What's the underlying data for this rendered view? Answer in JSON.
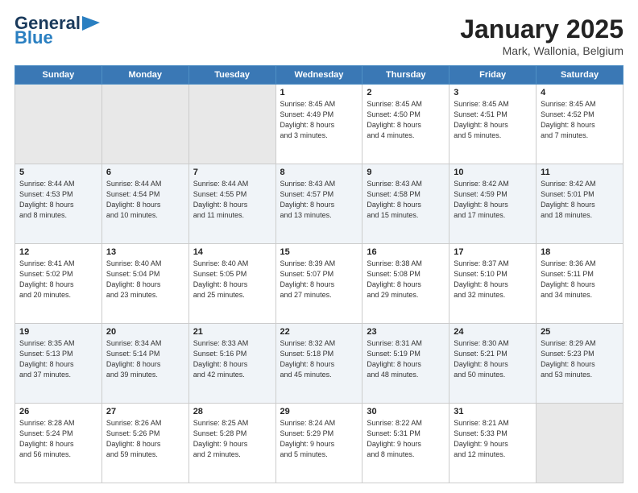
{
  "header": {
    "logo_line1": "General",
    "logo_line2": "Blue",
    "title": "January 2025",
    "subtitle": "Mark, Wallonia, Belgium"
  },
  "weekdays": [
    "Sunday",
    "Monday",
    "Tuesday",
    "Wednesday",
    "Thursday",
    "Friday",
    "Saturday"
  ],
  "weeks": [
    [
      {
        "day": "",
        "text": ""
      },
      {
        "day": "",
        "text": ""
      },
      {
        "day": "",
        "text": ""
      },
      {
        "day": "1",
        "text": "Sunrise: 8:45 AM\nSunset: 4:49 PM\nDaylight: 8 hours\nand 3 minutes."
      },
      {
        "day": "2",
        "text": "Sunrise: 8:45 AM\nSunset: 4:50 PM\nDaylight: 8 hours\nand 4 minutes."
      },
      {
        "day": "3",
        "text": "Sunrise: 8:45 AM\nSunset: 4:51 PM\nDaylight: 8 hours\nand 5 minutes."
      },
      {
        "day": "4",
        "text": "Sunrise: 8:45 AM\nSunset: 4:52 PM\nDaylight: 8 hours\nand 7 minutes."
      }
    ],
    [
      {
        "day": "5",
        "text": "Sunrise: 8:44 AM\nSunset: 4:53 PM\nDaylight: 8 hours\nand 8 minutes."
      },
      {
        "day": "6",
        "text": "Sunrise: 8:44 AM\nSunset: 4:54 PM\nDaylight: 8 hours\nand 10 minutes."
      },
      {
        "day": "7",
        "text": "Sunrise: 8:44 AM\nSunset: 4:55 PM\nDaylight: 8 hours\nand 11 minutes."
      },
      {
        "day": "8",
        "text": "Sunrise: 8:43 AM\nSunset: 4:57 PM\nDaylight: 8 hours\nand 13 minutes."
      },
      {
        "day": "9",
        "text": "Sunrise: 8:43 AM\nSunset: 4:58 PM\nDaylight: 8 hours\nand 15 minutes."
      },
      {
        "day": "10",
        "text": "Sunrise: 8:42 AM\nSunset: 4:59 PM\nDaylight: 8 hours\nand 17 minutes."
      },
      {
        "day": "11",
        "text": "Sunrise: 8:42 AM\nSunset: 5:01 PM\nDaylight: 8 hours\nand 18 minutes."
      }
    ],
    [
      {
        "day": "12",
        "text": "Sunrise: 8:41 AM\nSunset: 5:02 PM\nDaylight: 8 hours\nand 20 minutes."
      },
      {
        "day": "13",
        "text": "Sunrise: 8:40 AM\nSunset: 5:04 PM\nDaylight: 8 hours\nand 23 minutes."
      },
      {
        "day": "14",
        "text": "Sunrise: 8:40 AM\nSunset: 5:05 PM\nDaylight: 8 hours\nand 25 minutes."
      },
      {
        "day": "15",
        "text": "Sunrise: 8:39 AM\nSunset: 5:07 PM\nDaylight: 8 hours\nand 27 minutes."
      },
      {
        "day": "16",
        "text": "Sunrise: 8:38 AM\nSunset: 5:08 PM\nDaylight: 8 hours\nand 29 minutes."
      },
      {
        "day": "17",
        "text": "Sunrise: 8:37 AM\nSunset: 5:10 PM\nDaylight: 8 hours\nand 32 minutes."
      },
      {
        "day": "18",
        "text": "Sunrise: 8:36 AM\nSunset: 5:11 PM\nDaylight: 8 hours\nand 34 minutes."
      }
    ],
    [
      {
        "day": "19",
        "text": "Sunrise: 8:35 AM\nSunset: 5:13 PM\nDaylight: 8 hours\nand 37 minutes."
      },
      {
        "day": "20",
        "text": "Sunrise: 8:34 AM\nSunset: 5:14 PM\nDaylight: 8 hours\nand 39 minutes."
      },
      {
        "day": "21",
        "text": "Sunrise: 8:33 AM\nSunset: 5:16 PM\nDaylight: 8 hours\nand 42 minutes."
      },
      {
        "day": "22",
        "text": "Sunrise: 8:32 AM\nSunset: 5:18 PM\nDaylight: 8 hours\nand 45 minutes."
      },
      {
        "day": "23",
        "text": "Sunrise: 8:31 AM\nSunset: 5:19 PM\nDaylight: 8 hours\nand 48 minutes."
      },
      {
        "day": "24",
        "text": "Sunrise: 8:30 AM\nSunset: 5:21 PM\nDaylight: 8 hours\nand 50 minutes."
      },
      {
        "day": "25",
        "text": "Sunrise: 8:29 AM\nSunset: 5:23 PM\nDaylight: 8 hours\nand 53 minutes."
      }
    ],
    [
      {
        "day": "26",
        "text": "Sunrise: 8:28 AM\nSunset: 5:24 PM\nDaylight: 8 hours\nand 56 minutes."
      },
      {
        "day": "27",
        "text": "Sunrise: 8:26 AM\nSunset: 5:26 PM\nDaylight: 8 hours\nand 59 minutes."
      },
      {
        "day": "28",
        "text": "Sunrise: 8:25 AM\nSunset: 5:28 PM\nDaylight: 9 hours\nand 2 minutes."
      },
      {
        "day": "29",
        "text": "Sunrise: 8:24 AM\nSunset: 5:29 PM\nDaylight: 9 hours\nand 5 minutes."
      },
      {
        "day": "30",
        "text": "Sunrise: 8:22 AM\nSunset: 5:31 PM\nDaylight: 9 hours\nand 8 minutes."
      },
      {
        "day": "31",
        "text": "Sunrise: 8:21 AM\nSunset: 5:33 PM\nDaylight: 9 hours\nand 12 minutes."
      },
      {
        "day": "",
        "text": ""
      }
    ]
  ]
}
